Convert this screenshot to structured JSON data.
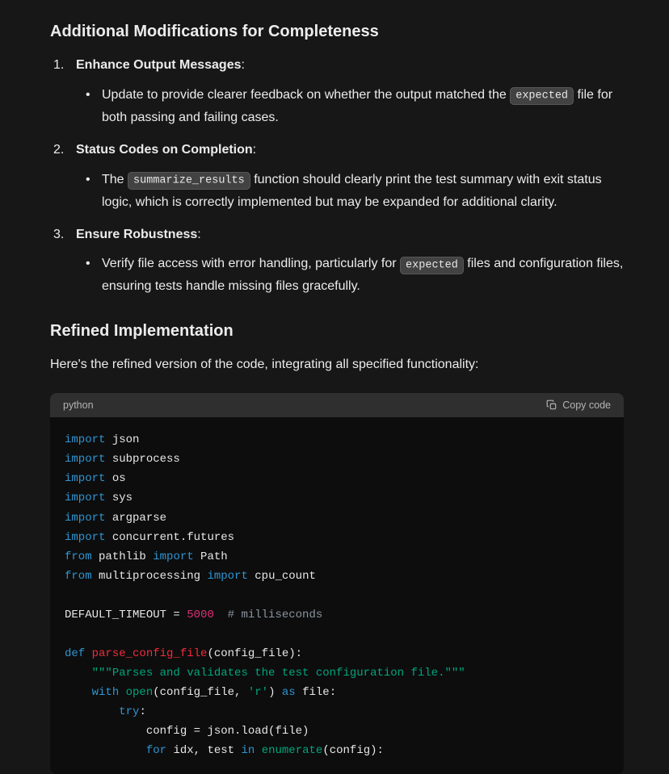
{
  "h_additional": "Additional Modifications for Completeness",
  "item1": {
    "title": "Enhance Output Messages",
    "colon": ":",
    "sub_a1": "Update to provide clearer feedback on whether the output matched the ",
    "sub_a_code": "expected",
    "sub_a2": " file for both passing and failing cases."
  },
  "item2": {
    "title": "Status Codes on Completion",
    "colon": ":",
    "sub_a1": "The ",
    "sub_a_code": "summarize_results",
    "sub_a2": " function should clearly print the test summary with exit status logic, which is correctly implemented but may be expanded for additional clarity."
  },
  "item3": {
    "title": "Ensure Robustness",
    "colon": ":",
    "sub_a1": "Verify file access with error handling, particularly for ",
    "sub_a_code": "expected",
    "sub_a2": " files and configuration files, ensuring tests handle missing files gracefully."
  },
  "h_refined": "Refined Implementation",
  "para_refined": "Here's the refined version of the code, integrating all specified functionality:",
  "code_lang": "python",
  "copy_label": "Copy code",
  "code": {
    "kw_import": "import",
    "kw_from": "from",
    "kw_def": "def",
    "kw_with": "with",
    "kw_as": "as",
    "kw_try": "try",
    "kw_for": "for",
    "kw_in": "in",
    "mod_json": " json",
    "mod_subprocess": " subprocess",
    "mod_os": " os",
    "mod_sys": " sys",
    "mod_argparse": " argparse",
    "mod_cf": " concurrent.futures",
    "mod_pathlib": " pathlib ",
    "name_Path": " Path",
    "mod_mp": " multiprocessing ",
    "name_cpu": " cpu_count",
    "dt_lhs": "DEFAULT_TIMEOUT = ",
    "dt_num": "5000",
    "dt_cmt": "  # milliseconds",
    "fn_name": "parse_config_file",
    "fn_sig": "(config_file):",
    "docstr": "\"\"\"Parses and validates the test configuration file.\"\"\"",
    "open_name": "open",
    "open_args1": "(config_file, ",
    "open_str": "'r'",
    "open_args2": ") ",
    "open_tail": " file:",
    "try_colon": ":",
    "jsonload": "            config = json.load(file)",
    "for_pre": "            ",
    "for_vars": " idx, test ",
    "enum_name": "enumerate",
    "enum_tail": "(config):"
  }
}
